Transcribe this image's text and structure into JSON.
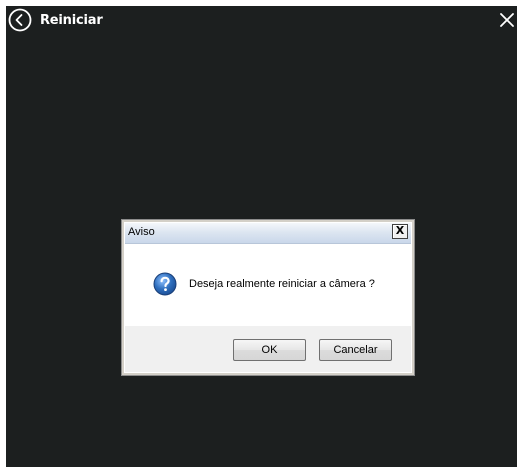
{
  "app": {
    "title": "Reiniciar"
  },
  "icons": {
    "back": "back-circle-icon",
    "close": "close-icon",
    "question": "question-icon"
  },
  "colors": {
    "background": "#1c1f1f",
    "header_text": "#ffffff",
    "dialog_bg": "#f0f0f0",
    "question_icon": "#2f6fbe"
  },
  "dialog": {
    "title": "Aviso",
    "close_label": "X",
    "message": "Deseja realmente reiniciar a câmera ?",
    "ok_label": "OK",
    "cancel_label": "Cancelar"
  }
}
